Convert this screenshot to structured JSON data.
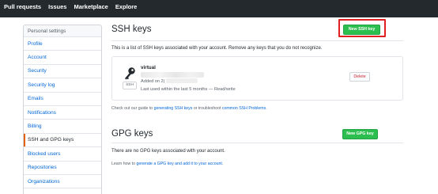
{
  "topnav": {
    "items": [
      "Pull requests",
      "Issues",
      "Marketplace",
      "Explore"
    ]
  },
  "sidebar": {
    "heading": "Personal settings",
    "items": [
      {
        "label": "Profile"
      },
      {
        "label": "Account"
      },
      {
        "label": "Security"
      },
      {
        "label": "Security log"
      },
      {
        "label": "Emails"
      },
      {
        "label": "Notifications"
      },
      {
        "label": "Billing"
      },
      {
        "label": "SSH and GPG keys",
        "active": true
      },
      {
        "label": "Blocked users"
      },
      {
        "label": "Repositories"
      },
      {
        "label": "Organizations"
      }
    ]
  },
  "ssh": {
    "title": "SSH keys",
    "new_button": "New SSH key",
    "description": "This is a list of SSH keys associated with your account. Remove any keys that you do not recognize.",
    "key": {
      "title": "virtual",
      "badge": "SSH",
      "added": "Added on 2(",
      "last_used": "Last used within the last 5 months — Read/write",
      "delete_label": "Delete",
      "icon": "key-icon"
    },
    "guide_prefix": "Check out our guide to ",
    "guide_link1": "generating SSH keys",
    "guide_mid": " or troubleshoot ",
    "guide_link2": "common SSH Problems",
    "guide_suffix": "."
  },
  "gpg": {
    "title": "GPG keys",
    "new_button": "New GPG key",
    "description": "There are no GPG keys associated with your account.",
    "learn_prefix": "Learn how to ",
    "learn_link": "generate a GPG key and add it to your account",
    "learn_suffix": "."
  },
  "colors": {
    "topbar": "#24292e",
    "primary_green": "#2cbe4e",
    "link_blue": "#0366d6",
    "danger_red": "#cb2431",
    "highlight_red": "#e02020",
    "active_marker": "#e36209"
  }
}
